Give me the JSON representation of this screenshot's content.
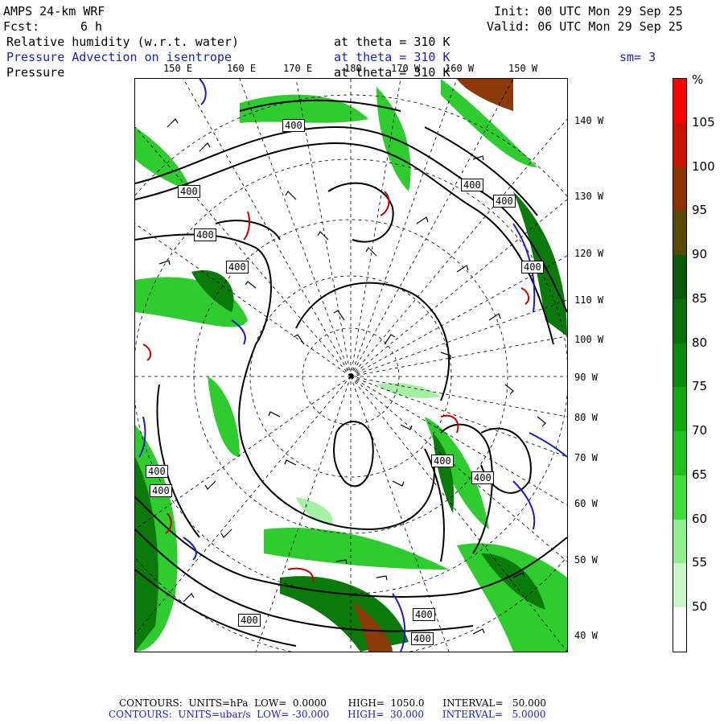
{
  "header": {
    "model": "AMPS 24-km WRF",
    "fcst_label": "Fcst:",
    "fcst_value": "6 h",
    "init": "Init: 00 UTC Mon 29 Sep 25",
    "valid": "Valid: 06 UTC Mon 29 Sep 25",
    "field1_name": "Relative humidity (w.r.t. water)",
    "field1_level": "at theta = 310 K",
    "field2_name": "Pressure Advection on isentrope",
    "field2_level": "at theta = 310 K",
    "field2_smooth": "sm= 3",
    "field3_name": "Pressure",
    "field3_level": "at theta = 310 K"
  },
  "map": {
    "top_longitudes": [
      "150 E",
      "160 E",
      "170 E",
      "180",
      "170 W",
      "160 W",
      "150 W"
    ],
    "right_longitudes": [
      "140 W",
      "130 W",
      "120 W",
      "110 W",
      "100 W",
      "90 W",
      "80 W",
      "70 W",
      "60 W",
      "50 W",
      "40 W"
    ],
    "contour_label": "400",
    "colors": {
      "contour_pressure": "#000000",
      "contour_adv_pos": "#cc0000",
      "contour_adv_neg": "#1a1acc",
      "rh_low": "#a6f0a6",
      "rh_mid": "#2ecc2e",
      "rh_high": "#0a7a0a",
      "rh_vhigh": "#8b3a0a"
    }
  },
  "colorbar": {
    "unit": "%",
    "labels": [
      "105",
      "100",
      "95",
      "90",
      "85",
      "80",
      "75",
      "70",
      "65",
      "60",
      "55",
      "50"
    ],
    "colors": [
      "#ff0000",
      "#cc1100",
      "#8b3300",
      "#5a4a00",
      "#0a5a0a",
      "#0a700a",
      "#0a8a0a",
      "#10aa10",
      "#20c020",
      "#40dd40",
      "#8ff08f",
      "#c8f8c8",
      "#ffffff"
    ]
  },
  "footer": {
    "line1": "CONTOURS:  UNITS=hPa  LOW=  0.0000       HIGH=  1050.0      INTERVAL=   50.000",
    "line2": "CONTOURS:  UNITS=ubar/s  LOW= -30.000      HIGH=  30.000      INTERVAL=   5.0000"
  }
}
